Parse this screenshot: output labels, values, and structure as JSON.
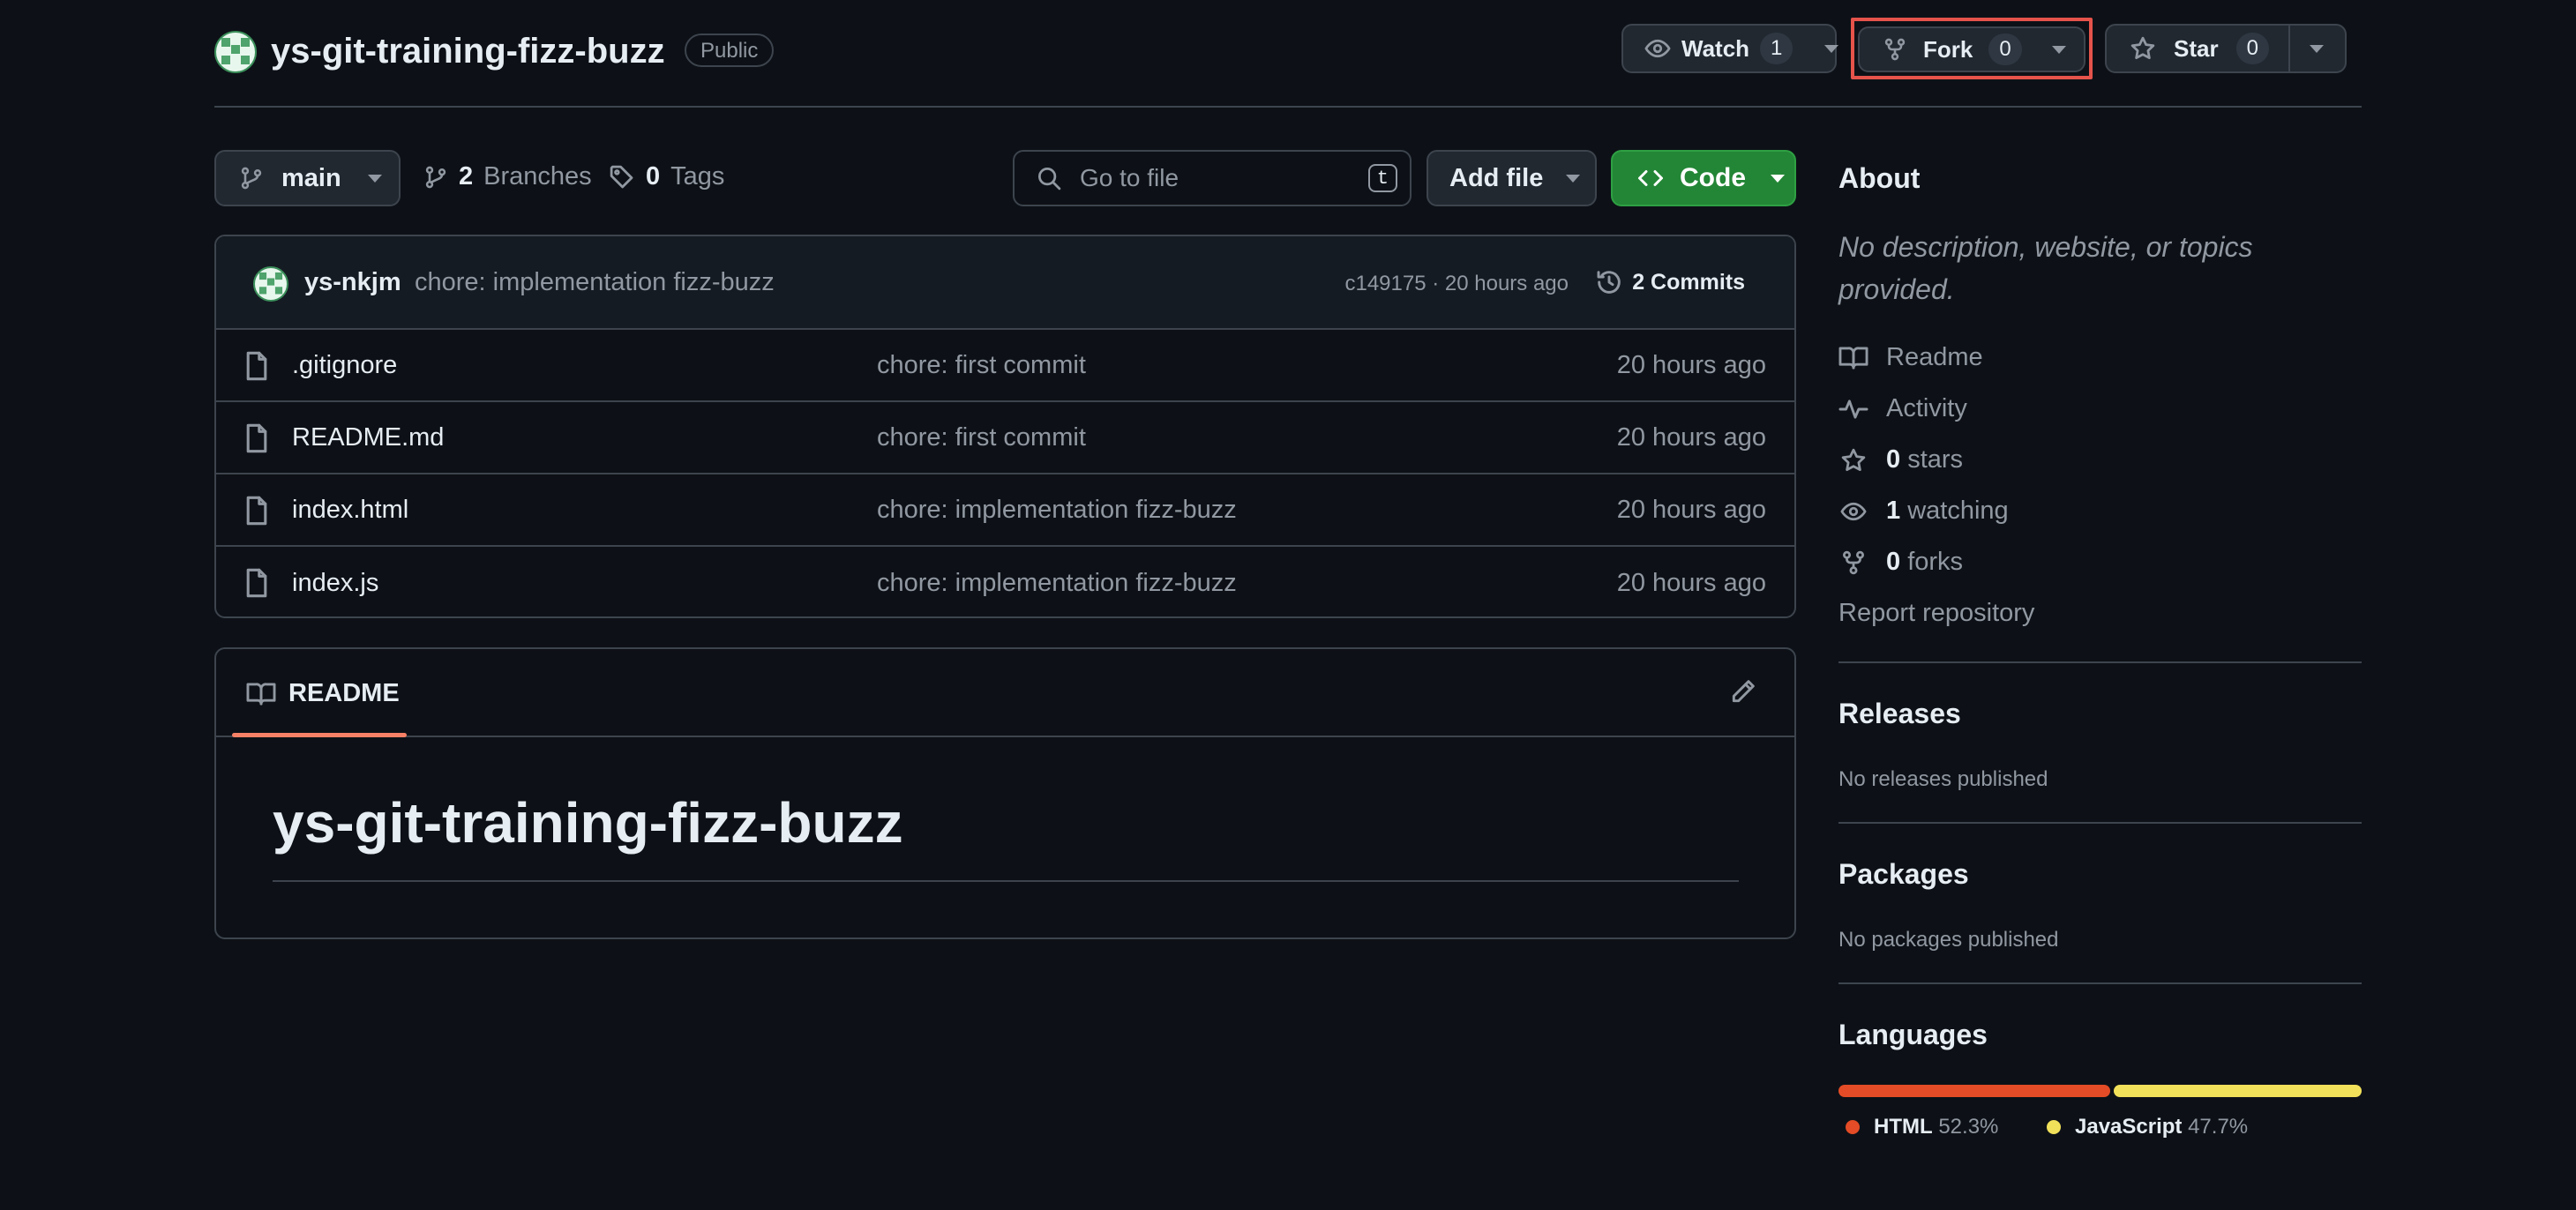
{
  "repo": {
    "name": "ys-git-training-fizz-buzz",
    "visibility": "Public",
    "avatar_icon": "identicon-avatar"
  },
  "actions": {
    "watch": {
      "label": "Watch",
      "count": "1"
    },
    "fork": {
      "label": "Fork",
      "count": "0"
    },
    "star": {
      "label": "Star",
      "count": "0"
    }
  },
  "toolbar": {
    "branch": "main",
    "branches": {
      "count": "2",
      "label": "Branches"
    },
    "tags": {
      "count": "0",
      "label": "Tags"
    },
    "search": {
      "placeholder": "Go to file",
      "shortcut": "t"
    },
    "add_file": "Add file",
    "code": "Code"
  },
  "latest_commit": {
    "author": "ys-nkjm",
    "message": "chore: implementation fizz-buzz",
    "meta": "c149175 · 20 hours ago",
    "commits": "2 Commits"
  },
  "files": [
    {
      "name": ".gitignore",
      "message": "chore: first commit",
      "date": "20 hours ago"
    },
    {
      "name": "README.md",
      "message": "chore: first commit",
      "date": "20 hours ago"
    },
    {
      "name": "index.html",
      "message": "chore: implementation fizz-buzz",
      "date": "20 hours ago"
    },
    {
      "name": "index.js",
      "message": "chore: implementation fizz-buzz",
      "date": "20 hours ago"
    }
  ],
  "readme": {
    "tab": "README",
    "heading": "ys-git-training-fizz-buzz"
  },
  "sidebar": {
    "about": {
      "title": "About",
      "description": "No description, website, or topics provided.",
      "readme": "Readme",
      "activity": "Activity",
      "stars": {
        "count": "0",
        "label": "stars"
      },
      "watching": {
        "count": "1",
        "label": "watching"
      },
      "forks": {
        "count": "0",
        "label": "forks"
      },
      "report": "Report repository"
    },
    "releases": {
      "title": "Releases",
      "text": "No releases published"
    },
    "packages": {
      "title": "Packages",
      "text": "No packages published"
    },
    "languages": {
      "title": "Languages",
      "items": [
        {
          "name": "HTML",
          "percent": "52.3%",
          "share": 0.523,
          "color": "#e34c26"
        },
        {
          "name": "JavaScript",
          "percent": "47.7%",
          "share": 0.477,
          "color": "#f1e05a"
        }
      ]
    }
  },
  "colors": {
    "background": "#0d1117",
    "border": "#3d444d",
    "code_button": "#238636",
    "highlight": "#e5534b",
    "tab_underline": "#f78166"
  }
}
